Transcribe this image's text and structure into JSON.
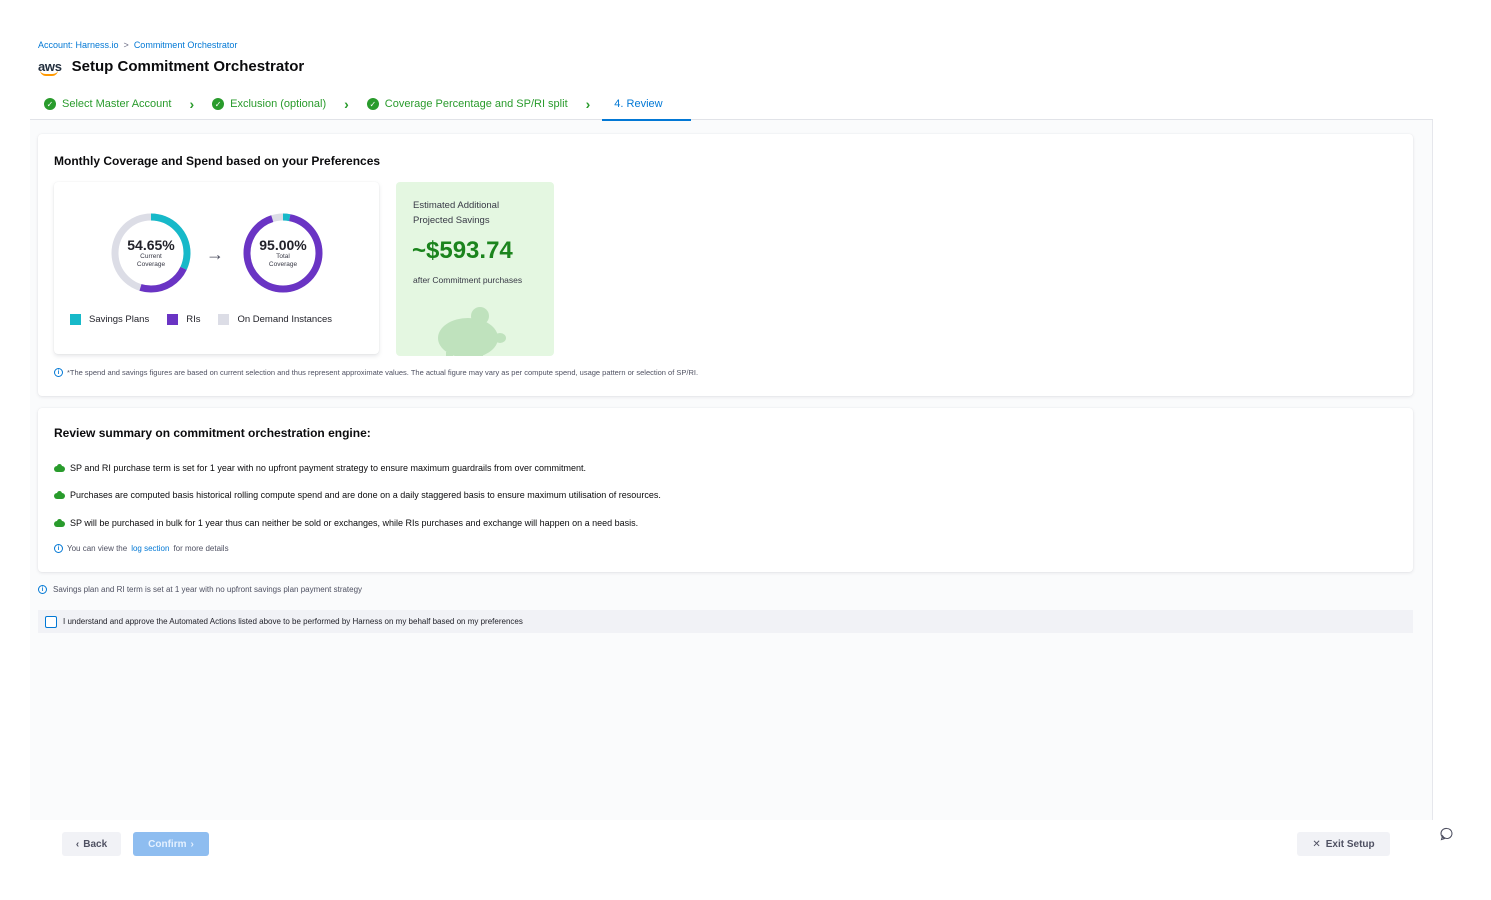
{
  "breadcrumb": {
    "account": "Account: Harness.io",
    "separator": ">",
    "current": "Commitment Orchestrator"
  },
  "header": {
    "logo_text": "aws",
    "title": "Setup Commitment Orchestrator"
  },
  "steps": [
    {
      "label": "Select Master Account",
      "status": "complete"
    },
    {
      "label": "Exclusion (optional)",
      "status": "complete"
    },
    {
      "label": "Coverage Percentage and SP/RI split",
      "status": "complete"
    },
    {
      "label": "4. Review",
      "status": "active"
    }
  ],
  "coverage": {
    "heading": "Monthly Coverage and Spend based on your Preferences",
    "current": {
      "value": "54.65%",
      "label_line1": "Current",
      "label_line2": "Coverage",
      "savings_plans_fraction": 0.32,
      "ris_fraction": 0.2265
    },
    "total": {
      "value": "95.00%",
      "label_line1": "Total",
      "label_line2": "Coverage",
      "savings_plans_fraction": 0.03,
      "ris_fraction": 0.92
    },
    "legend": [
      {
        "label": "Savings Plans",
        "color": "#17b9c9"
      },
      {
        "label": "RIs",
        "color": "#6a34c4"
      },
      {
        "label": "On Demand Instances",
        "color": "#dcdde6"
      }
    ],
    "savings": {
      "label": "Estimated Additional Projected Savings",
      "value": "~$593.74",
      "after": "after Commitment purchases"
    },
    "disclaimer": "*The spend and savings figures are based on current selection and thus represent approximate values. The actual figure may vary as per compute spend, usage pattern or selection of SP/RI."
  },
  "review": {
    "heading": "Review summary on commitment orchestration engine:",
    "points": [
      "SP and RI purchase term is set for 1 year with no upfront payment strategy to ensure maximum guardrails from over commitment.",
      "Purchases are computed basis historical rolling compute spend and are done on a daily staggered basis to ensure maximum utilisation of resources.",
      "SP will be purchased in bulk for 1 year thus can neither be sold or exchanges, while RIs purchases and exchange will happen on a need basis."
    ],
    "log_prefix": "You can view the",
    "log_link": "log section",
    "log_suffix": "for more details"
  },
  "term_note": "Savings plan and RI term is set at 1 year with no upfront savings plan payment strategy",
  "approval": {
    "label": "I understand and approve the Automated Actions listed above to be performed by Harness on my behalf based on my preferences",
    "checked": false
  },
  "footer": {
    "back_label": "Back",
    "confirm_label": "Confirm",
    "exit_label": "Exit Setup"
  },
  "colors": {
    "accent": "#0278d5",
    "success": "#299b2c",
    "savings_green": "#1b841d"
  }
}
